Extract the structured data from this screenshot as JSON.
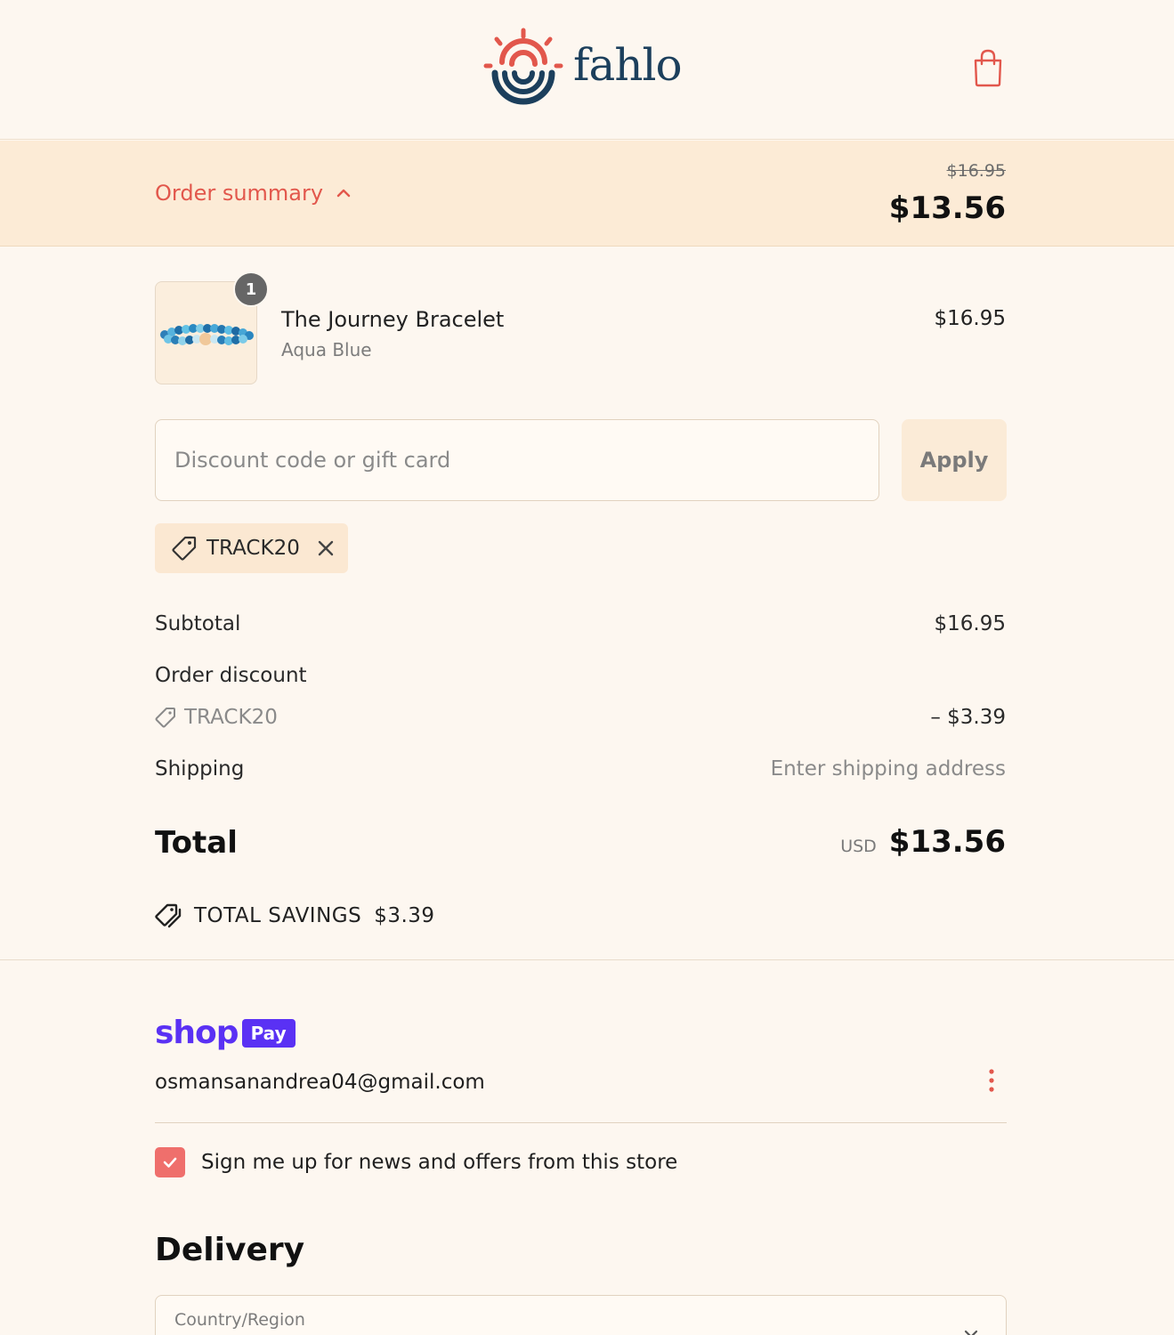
{
  "brand": {
    "name": "fahlo",
    "primary_color": "#e2574c",
    "navy_color": "#1c3f5c"
  },
  "header": {
    "cart_icon": "shopping-bag-icon"
  },
  "order_summary": {
    "toggle_label": "Order summary",
    "original_price": "$16.95",
    "discounted_price": "$13.56"
  },
  "product": {
    "quantity": "1",
    "name": "The Journey Bracelet",
    "variant": "Aqua Blue",
    "price": "$16.95"
  },
  "discount": {
    "placeholder": "Discount code or gift card",
    "apply_label": "Apply",
    "applied_code": "TRACK20"
  },
  "totals": {
    "subtotal_label": "Subtotal",
    "subtotal_value": "$16.95",
    "order_discount_label": "Order discount",
    "discount_code": "TRACK20",
    "discount_value": "– $3.39",
    "shipping_label": "Shipping",
    "shipping_value": "Enter shipping address",
    "total_label": "Total",
    "currency": "USD",
    "total_value": "$13.56",
    "savings_label": "TOTAL SAVINGS",
    "savings_value": "$3.39"
  },
  "shop_pay": {
    "shop_word": "shop",
    "pay_word": "Pay",
    "brand_color": "#5a31f4",
    "email": "osmansanandrea04@gmail.com"
  },
  "newsletter": {
    "checked": true,
    "label": "Sign me up for news and offers from this store"
  },
  "delivery": {
    "heading": "Delivery",
    "country_label": "Country/Region"
  }
}
